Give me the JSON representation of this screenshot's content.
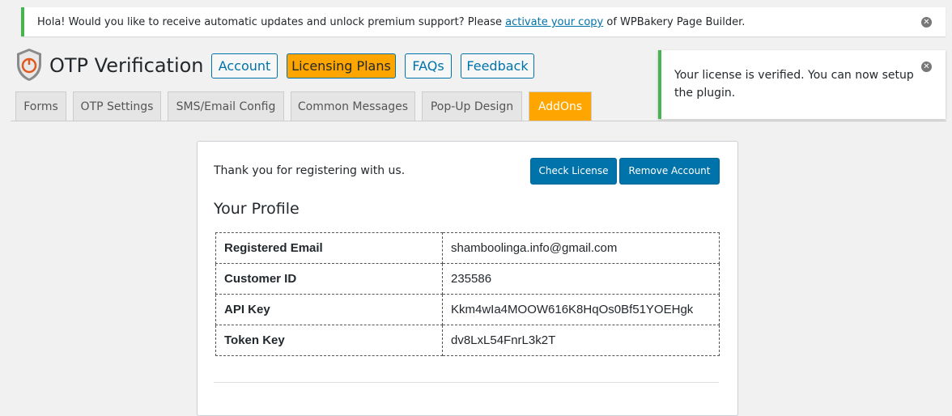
{
  "notice": {
    "text_before": "Hola! Would you like to receive automatic updates and unlock premium support? Please ",
    "link": "activate your copy",
    "text_after": " of WPBakery Page Builder."
  },
  "header": {
    "title": "OTP Verification",
    "buttons": [
      "Account",
      "Licensing Plans",
      "FAQs",
      "Feedback"
    ]
  },
  "tabs": [
    "Forms",
    "OTP Settings",
    "SMS/Email Config",
    "Common Messages",
    "Pop-Up Design",
    "AddOns"
  ],
  "license_notice": {
    "text": "Your license is verified. You can now setup the plugin."
  },
  "panel": {
    "thanks": "Thank you for registering with us.",
    "check_license": "Check License",
    "remove_account": "Remove Account",
    "profile_heading": "Your Profile",
    "rows": [
      {
        "label": "Registered Email",
        "value": "shamboolinga.info@gmail.com"
      },
      {
        "label": "Customer ID",
        "value": "235586"
      },
      {
        "label": "API Key",
        "value": "Kkm4wIa4MOOW616K8HqOs0Bf51YOEHgk"
      },
      {
        "label": "Token Key",
        "value": "dv8LxL54FnrL3k2T"
      }
    ]
  },
  "colors": {
    "accent": "#0073aa",
    "orange": "#ffa500",
    "success": "#46b450"
  },
  "icons": {
    "logo": "shield-otp-logo",
    "dismiss": "close-circle-icon"
  }
}
